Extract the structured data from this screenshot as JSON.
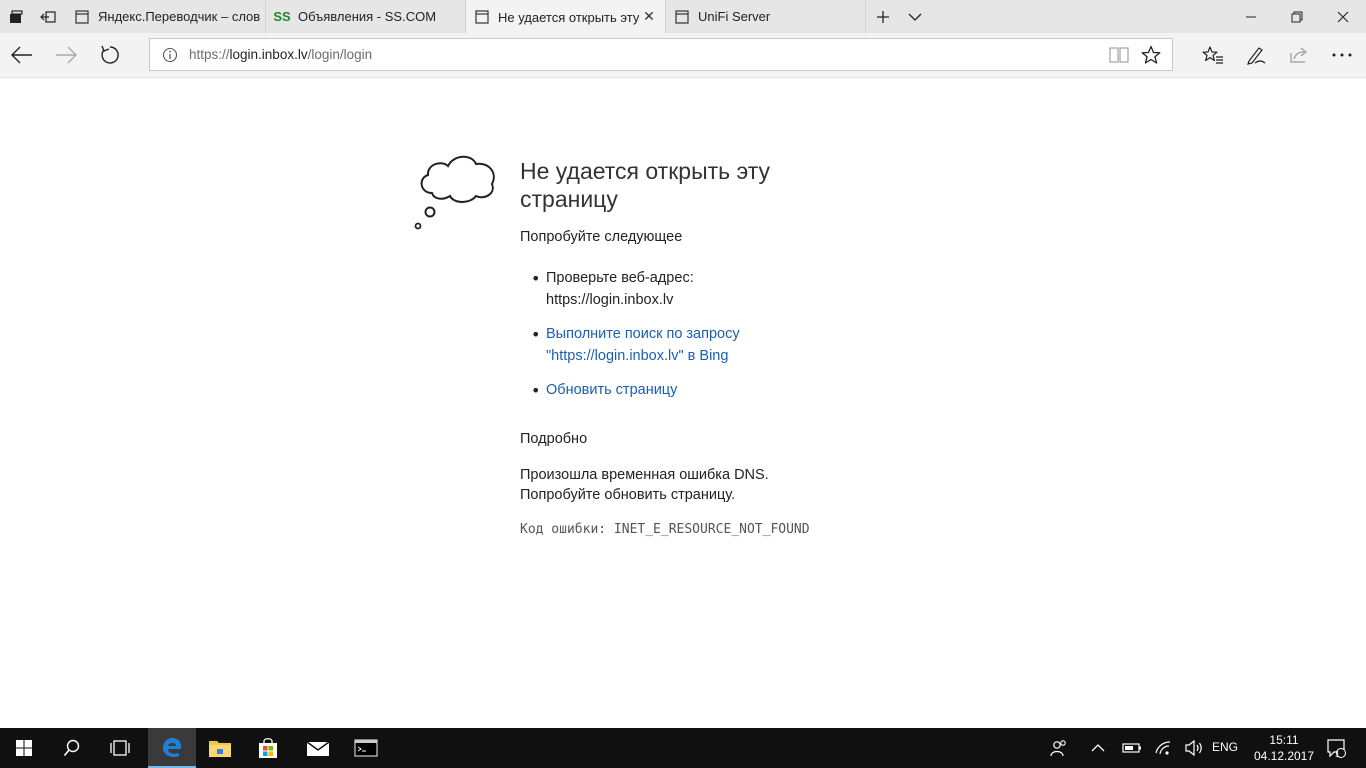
{
  "tabs": [
    {
      "title": "Яндекс.Переводчик – слов",
      "favicon": "page-icon"
    },
    {
      "title": "Объявления - SS.COM",
      "favicon_text": "SS"
    },
    {
      "title": "Не удается открыть эту",
      "favicon": "page-icon",
      "active": true,
      "close": "✕"
    },
    {
      "title": "UniFi Server",
      "favicon": "page-icon"
    }
  ],
  "address": {
    "prefix": "https://",
    "host": "login.inbox.lv",
    "path": "/login/login"
  },
  "error_page": {
    "title_line1": "Не удается открыть эту",
    "title_line2": "страницу",
    "try_label": "Попробуйте следующее",
    "items": [
      {
        "line1": "Проверьте веб-адрес:",
        "line2": "https://login.inbox.lv"
      },
      {
        "line1": "Выполните поиск по запросу",
        "line2": "\"https://login.inbox.lv\" в Bing"
      },
      {
        "line1": "Обновить страницу"
      }
    ],
    "details_label": "Подробно",
    "dns_line1": "Произошла временная ошибка DNS.",
    "dns_line2": "Попробуйте обновить страницу.",
    "error_code": "Код ошибки:  INET_E_RESOURCE_NOT_FOUND"
  },
  "taskbar": {
    "lang": "ENG",
    "time": "15:11",
    "date": "04.12.2017",
    "notification_count": "1"
  },
  "colors": {
    "link": "#1a5fb4",
    "taskbar_bg": "#101010",
    "taskbar_active_underline": "#76b9ed",
    "edge_blue": "#1f7fd6"
  }
}
